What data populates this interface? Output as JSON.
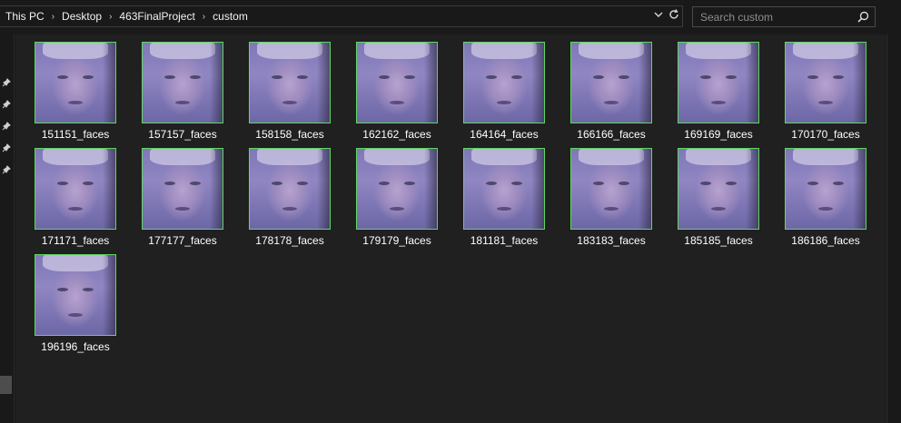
{
  "breadcrumb": [
    "This PC",
    "Desktop",
    "463FinalProject",
    "custom"
  ],
  "search": {
    "placeholder": "Search custom"
  },
  "files": [
    "151151_faces",
    "157157_faces",
    "158158_faces",
    "162162_faces",
    "164164_faces",
    "166166_faces",
    "169169_faces",
    "170170_faces",
    "171171_faces",
    "177177_faces",
    "178178_faces",
    "179179_faces",
    "181181_faces",
    "183183_faces",
    "185185_faces",
    "186186_faces",
    "196196_faces"
  ],
  "colors": {
    "background": "#202020",
    "thumbnail_border": "#5fd860",
    "text": "#ffffff"
  },
  "icons": {
    "dropdown": "chevron-down-icon",
    "refresh": "refresh-icon",
    "search": "search-icon",
    "pin": "pin-icon"
  }
}
